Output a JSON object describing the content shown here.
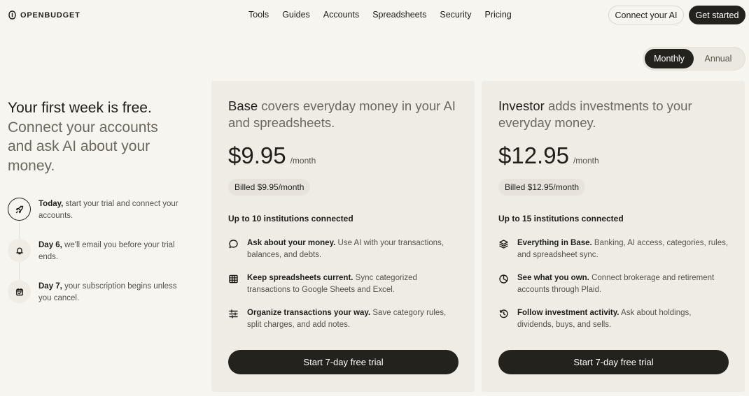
{
  "header": {
    "brand": "OPENBUDGET",
    "nav": [
      "Tools",
      "Guides",
      "Accounts",
      "Spreadsheets",
      "Security",
      "Pricing"
    ],
    "connect_label": "Connect your AI",
    "cta_label": "Get started"
  },
  "billing_toggle": {
    "monthly": "Monthly",
    "annual": "Annual",
    "selected": "Monthly"
  },
  "hero": {
    "lead": "Your first week is free.",
    "rest": " Connect your accounts and ask AI about your money."
  },
  "timeline": [
    {
      "title": "Today,",
      "text": " start your trial and connect your accounts.",
      "icon": "rocket-icon"
    },
    {
      "title": "Day 6,",
      "text": " we'll email you before your trial ends.",
      "icon": "bell-icon"
    },
    {
      "title": "Day 7,",
      "text": " your subscription begins unless you cancel.",
      "icon": "calendar-check-icon"
    }
  ],
  "plans": {
    "base": {
      "name": "Base",
      "tagline": " covers everyday money in your AI and spreadsheets.",
      "price": "$9.95",
      "period": "/month",
      "billed": "Billed $9.95/month",
      "institutions": "Up to 10 institutions connected",
      "features": [
        {
          "icon": "chat-bubble-icon",
          "title": "Ask about your money.",
          "text": " Use AI with your transactions, balances, and debts."
        },
        {
          "icon": "table-icon",
          "title": "Keep spreadsheets current.",
          "text": " Sync categorized transactions to Google Sheets and Excel."
        },
        {
          "icon": "sliders-icon",
          "title": "Organize transactions your way.",
          "text": " Save category rules, split charges, and add notes."
        }
      ],
      "cta": "Start 7-day free trial"
    },
    "investor": {
      "name": "Investor",
      "tagline": " adds investments to your everyday money.",
      "price": "$12.95",
      "period": "/month",
      "billed": "Billed $12.95/month",
      "institutions": "Up to 15 institutions connected",
      "features": [
        {
          "icon": "layers-icon",
          "title": "Everything in Base.",
          "text": " Banking, AI access, categories, rules, and spreadsheet sync."
        },
        {
          "icon": "pie-chart-icon",
          "title": "See what you own.",
          "text": " Connect brokerage and retirement accounts through Plaid."
        },
        {
          "icon": "history-icon",
          "title": "Follow investment activity.",
          "text": " Ask about holdings, dividends, buys, and sells."
        }
      ],
      "cta": "Start 7-day free trial"
    }
  },
  "colors": {
    "background": "#f7f5f0",
    "card": "#efece6",
    "dark": "#23221d",
    "muted_text": "#6b6860"
  }
}
